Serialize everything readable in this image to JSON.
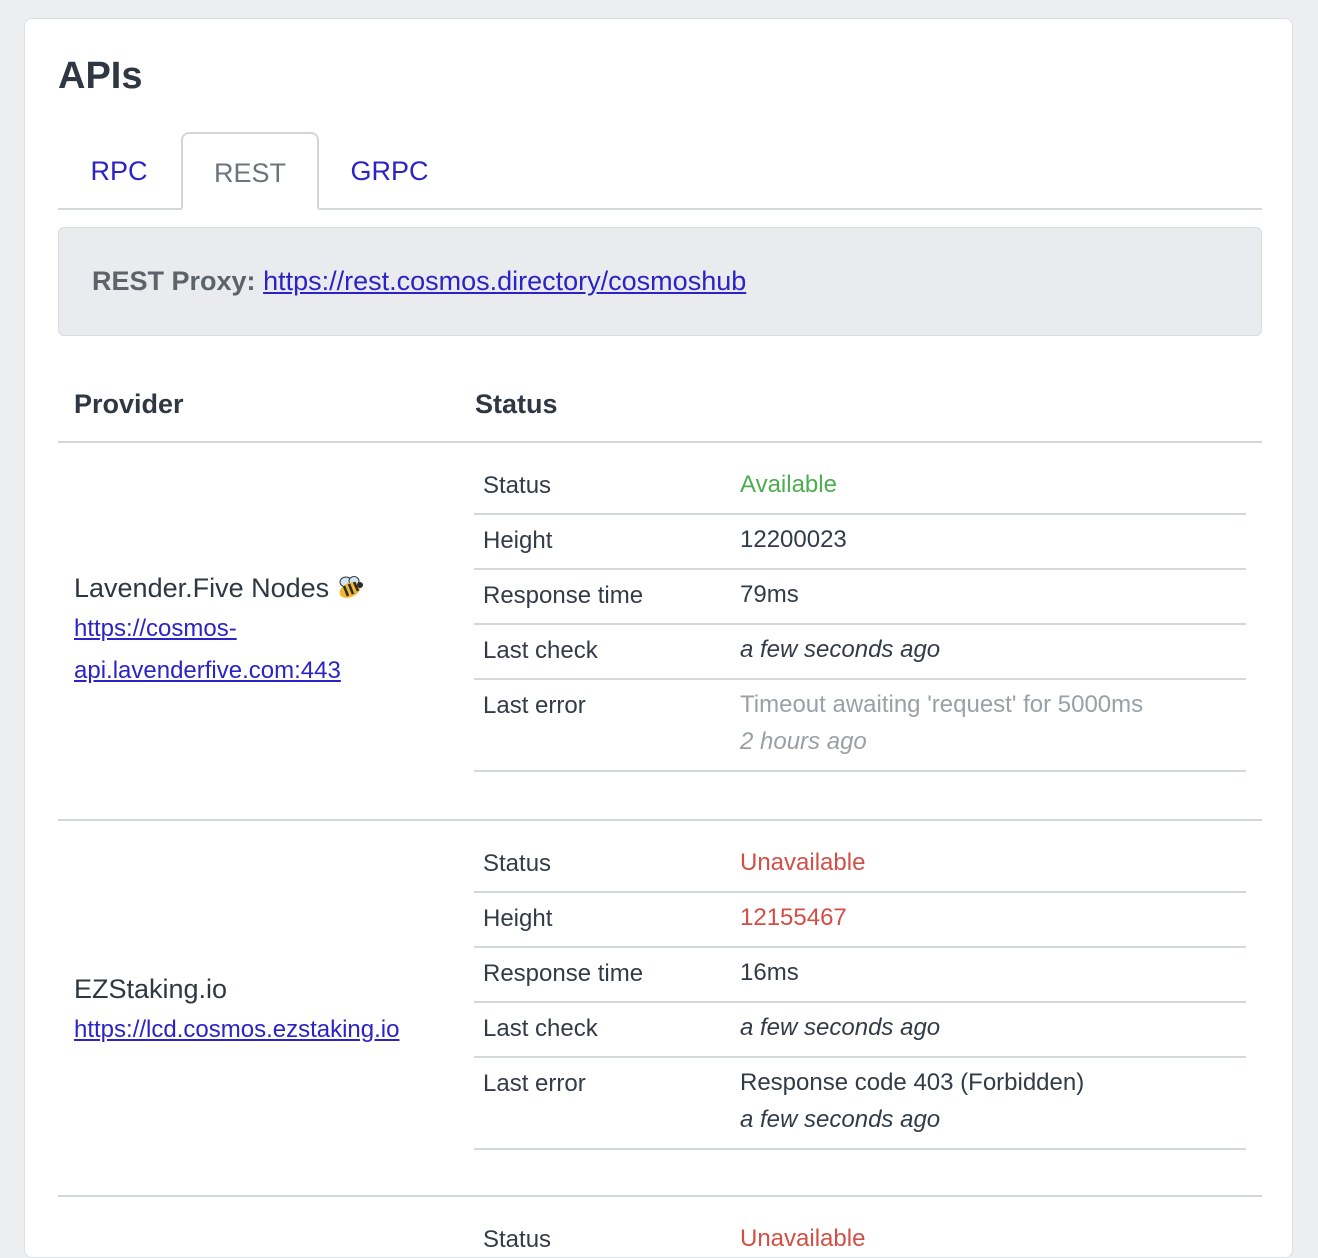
{
  "page": {
    "title": "APIs"
  },
  "tabs": [
    {
      "label": "RPC",
      "active": false
    },
    {
      "label": "REST",
      "active": true
    },
    {
      "label": "GRPC",
      "active": false
    }
  ],
  "proxy": {
    "label": "REST Proxy:",
    "url": "https://rest.cosmos.directory/cosmoshub"
  },
  "table": {
    "headers": {
      "provider": "Provider",
      "status": "Status"
    },
    "providers": [
      {
        "name": "Lavender.Five Nodes",
        "icon": "bee-icon",
        "url_line1": "https://cosmos-",
        "url_line2": "api.lavenderfive.com:443",
        "status": {
          "status_key": "Status",
          "status_value": "Available",
          "height_key": "Height",
          "height_value": "12200023",
          "response_key": "Response time",
          "response_value": "79ms",
          "last_check_key": "Last check",
          "last_check_value": "a few seconds ago",
          "last_error_key": "Last error",
          "last_error_value": "Timeout awaiting 'request' for 5000ms",
          "last_error_time": "2 hours ago"
        }
      },
      {
        "name": "EZStaking.io",
        "url": "https://lcd.cosmos.ezstaking.io",
        "status": {
          "status_key": "Status",
          "status_value": "Unavailable",
          "height_key": "Height",
          "height_value": "12155467",
          "response_key": "Response time",
          "response_value": "16ms",
          "last_check_key": "Last check",
          "last_check_value": "a few seconds ago",
          "last_error_key": "Last error",
          "last_error_value": "Response code 403 (Forbidden)",
          "last_error_time": "a few seconds ago"
        }
      },
      {
        "status": {
          "status_key": "Status",
          "status_value": "Unavailable"
        }
      }
    ]
  },
  "colors": {
    "link": "#2b23c6",
    "available": "#4cae4f",
    "unavailable": "#d24f47",
    "muted": "#9aa0a6"
  }
}
